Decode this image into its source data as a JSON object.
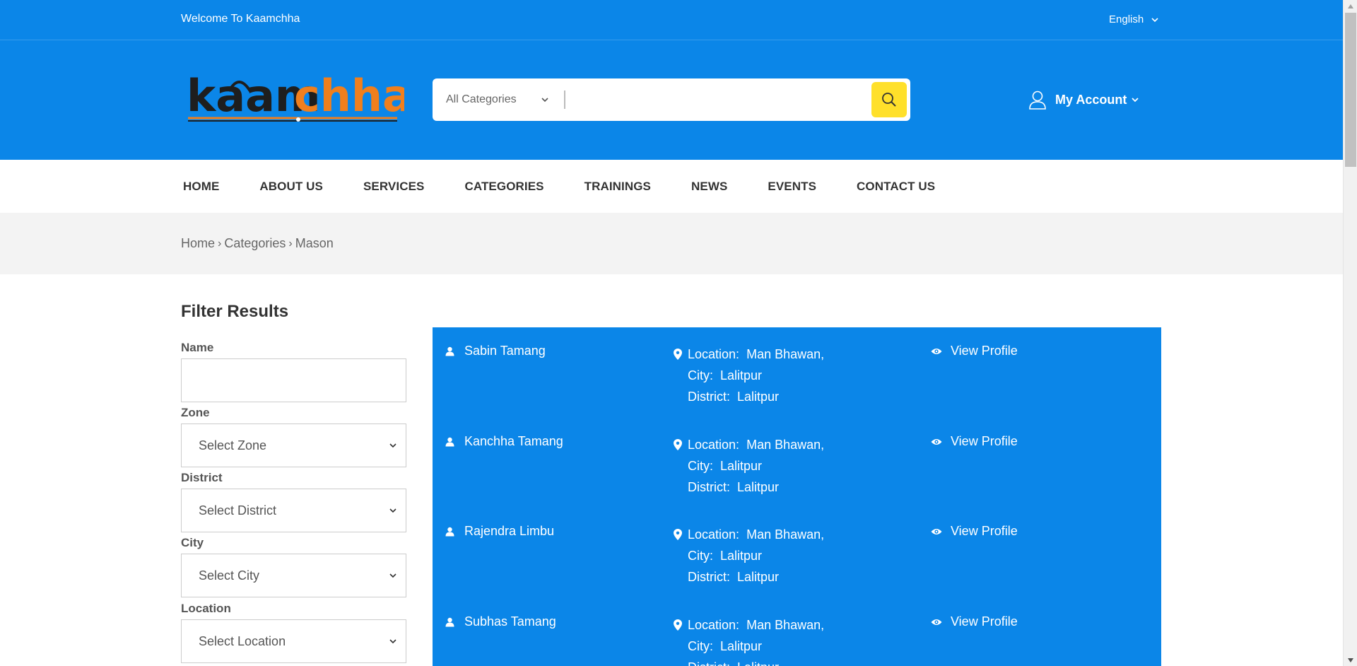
{
  "topbar": {
    "welcome": "Welcome To Kaamchha",
    "language": "English"
  },
  "logo": {
    "text_dark": "kaam",
    "text_orange": "chha"
  },
  "search": {
    "category": "All Categories",
    "query": "",
    "button_icon": "search-icon"
  },
  "account": {
    "label": "My Account"
  },
  "nav": {
    "items": [
      "HOME",
      "ABOUT US",
      "SERVICES",
      "CATEGORIES",
      "TRAININGS",
      "NEWS",
      "EVENTS",
      "CONTACT US"
    ]
  },
  "breadcrumb": {
    "items": [
      "Home",
      "Categories",
      "Mason"
    ]
  },
  "filter": {
    "title": "Filter Results",
    "name_label": "Name",
    "name_value": "",
    "zone_label": "Zone",
    "zone_value": "Select Zone",
    "district_label": "District",
    "district_value": "Select District",
    "city_label": "City",
    "city_value": "Select City",
    "location_label": "Location",
    "location_value": "Select Location"
  },
  "results": {
    "location_prefix": "Location:",
    "city_prefix": "City:",
    "district_prefix": "District:",
    "view_label": "View Profile",
    "items": [
      {
        "name": "Sabin Tamang",
        "location": "Man Bhawan,",
        "city": "Lalitpur",
        "district": "Lalitpur"
      },
      {
        "name": "Kanchha Tamang",
        "location": "Man Bhawan,",
        "city": "Lalitpur",
        "district": "Lalitpur"
      },
      {
        "name": "Rajendra Limbu",
        "location": "Man Bhawan,",
        "city": "Lalitpur",
        "district": "Lalitpur"
      },
      {
        "name": "Subhas Tamang",
        "location": "Man Bhawan,",
        "city": "Lalitpur",
        "district": "Lalitpur"
      }
    ]
  },
  "colors": {
    "brand_blue": "#0b86e8",
    "search_button": "#ffe02a",
    "logo_orange": "#f07f1d",
    "logo_dark": "#1e1e1e"
  }
}
